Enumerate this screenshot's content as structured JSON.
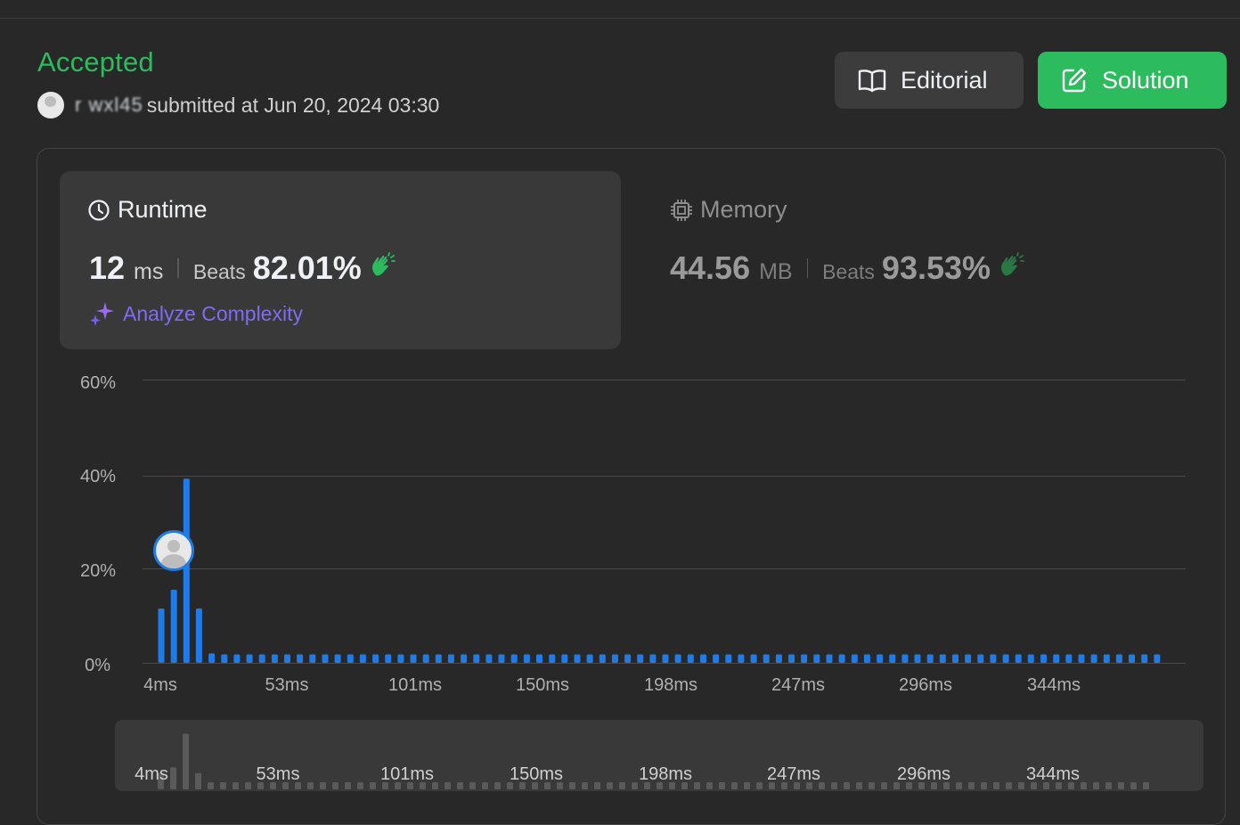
{
  "header": {
    "status": "Accepted",
    "username": "r wxl45",
    "submitted_text": "submitted at Jun 20, 2024 03:30"
  },
  "buttons": {
    "editorial": "Editorial",
    "solution": "Solution"
  },
  "runtime": {
    "title": "Runtime",
    "value": "12",
    "unit": "ms",
    "beats_label": "Beats",
    "percent": "82.01%",
    "analyze": "Analyze Complexity"
  },
  "memory": {
    "title": "Memory",
    "value": "44.56",
    "unit": "MB",
    "beats_label": "Beats",
    "percent": "93.53%"
  },
  "colors": {
    "accepted": "#2cbb5d",
    "bar": "#1e7be8",
    "analyze": "#7f6cf0"
  },
  "chart_data": {
    "type": "bar",
    "ylim": [
      0,
      60
    ],
    "y_ticks": [
      "60%",
      "40%",
      "20%",
      "0%"
    ],
    "x_ticks": [
      "4ms",
      "53ms",
      "101ms",
      "150ms",
      "198ms",
      "247ms",
      "296ms",
      "344ms"
    ],
    "x_range_ms": [
      4,
      398
    ],
    "bin_width_ms": 5,
    "values": [
      11.5,
      15.5,
      39,
      11.5,
      2,
      1.8,
      1.8,
      1.8,
      1.8,
      1.8,
      1.8,
      1.8,
      1.8,
      1.8,
      1.8,
      1.8,
      1.8,
      1.8,
      1.8,
      1.8,
      1.8,
      1.8,
      1.8,
      1.8,
      1.8,
      1.8,
      1.8,
      1.8,
      1.8,
      1.8,
      1.8,
      1.8,
      1.8,
      1.8,
      1.8,
      1.8,
      1.8,
      1.8,
      1.8,
      1.8,
      1.8,
      1.8,
      1.8,
      1.8,
      1.8,
      1.8,
      1.8,
      1.8,
      1.8,
      1.8,
      1.8,
      1.8,
      1.8,
      1.8,
      1.8,
      1.8,
      1.8,
      1.8,
      1.8,
      1.8,
      1.8,
      1.8,
      1.8,
      1.8,
      1.8,
      1.8,
      1.8,
      1.8,
      1.8,
      1.8,
      1.8,
      1.8,
      1.8,
      1.8,
      1.8,
      1.8,
      1.8,
      1.8,
      1.8,
      1.8
    ],
    "user_bin_index": 1,
    "grid": true
  }
}
